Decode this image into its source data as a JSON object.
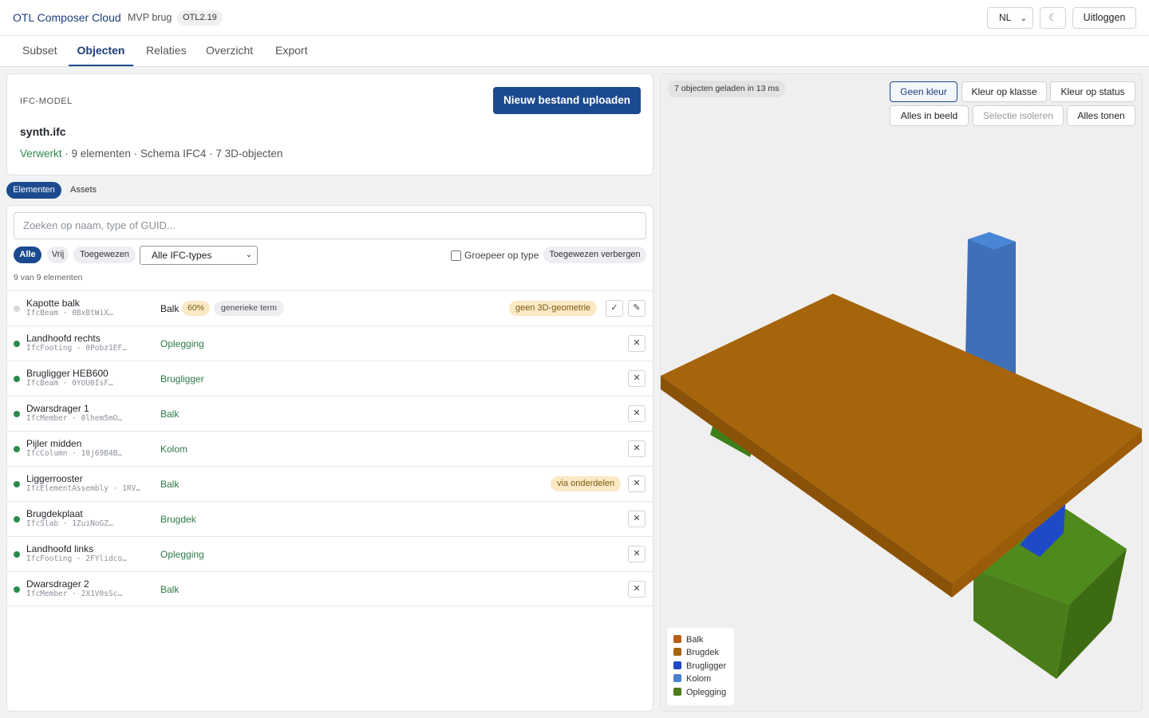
{
  "header": {
    "brand": "OTL Composer Cloud",
    "project": "MVP brug",
    "version": "OTL2.19",
    "language": "NL",
    "theme_icon": "☾",
    "logout": "Uitloggen"
  },
  "tabs": [
    "Subset",
    "Objecten",
    "Relaties",
    "Overzicht",
    "Export"
  ],
  "active_tab": "Objecten",
  "ifc": {
    "section_label": "IFC-MODEL",
    "upload_button": "Nieuw bestand uploaden",
    "file_name": "synth.ifc",
    "status": "Verwerkt",
    "meta": " · 9 elementen · Schema IFC4 · 7 3D-objecten"
  },
  "subtabs": {
    "elements": "Elementen",
    "assets": "Assets"
  },
  "list": {
    "search_placeholder": "Zoeken op naam, type of GUID...",
    "filters": {
      "all": "Alle",
      "free": "Vrij",
      "assigned": "Toegewezen"
    },
    "type_filter": "Alle IFC-types",
    "group_by_type": "Groepeer op type",
    "hide_assigned": "Toegewezen verbergen",
    "count": "9 van 9 elementen",
    "rows": [
      {
        "name": "Kapotte balk",
        "sub": "IfcBeam · 0BxBtWiX…",
        "cls": "Balk",
        "pct": "60%",
        "term": "generieke term",
        "badge": "geen 3D-geometrie",
        "accept": "✓",
        "edit": "✎"
      },
      {
        "name": "Landhoofd rechts",
        "sub": "IfcFooting · 0Pobz1EF…",
        "cls": "Oplegging",
        "remove": "✕"
      },
      {
        "name": "Brugligger HEB600",
        "sub": "IfcBeam · 0YOU0IsF…",
        "cls": "Brugligger",
        "remove": "✕"
      },
      {
        "name": "Dwarsdrager 1",
        "sub": "IfcMember · 0lhem5mO…",
        "cls": "Balk",
        "remove": "✕"
      },
      {
        "name": "Pijler midden",
        "sub": "IfcColumn · 10j69B4B…",
        "cls": "Kolom",
        "remove": "✕"
      },
      {
        "name": "Liggerrooster",
        "sub": "IfcElementAssembly · 1RV…",
        "cls": "Balk",
        "badge": "via onderdelen",
        "remove": "✕"
      },
      {
        "name": "Brugdekplaat",
        "sub": "IfcSlab · 1ZuiNoGZ…",
        "cls": "Brugdek",
        "remove": "✕"
      },
      {
        "name": "Landhoofd links",
        "sub": "IfcFooting · 2FYlidco…",
        "cls": "Oplegging",
        "remove": "✕"
      },
      {
        "name": "Dwarsdrager 2",
        "sub": "IfcMember · 2X1V0sSc…",
        "cls": "Balk",
        "remove": "✕"
      }
    ]
  },
  "viewer": {
    "stats": "7 objecten geladen in 13 ms",
    "buttons": {
      "no_color": "Geen kleur",
      "by_class": "Kleur op klasse",
      "by_status": "Kleur op status",
      "fit": "Alles in beeld",
      "isolate": "Selectie isoleren",
      "show_all": "Alles tonen"
    },
    "legend": [
      {
        "label": "Balk",
        "color": "#b85f16"
      },
      {
        "label": "Brugdek",
        "color": "#a6650a"
      },
      {
        "label": "Brugligger",
        "color": "#1f49c6"
      },
      {
        "label": "Kolom",
        "color": "#4a7fd0"
      },
      {
        "label": "Oplegging",
        "color": "#4a7d19"
      }
    ]
  }
}
